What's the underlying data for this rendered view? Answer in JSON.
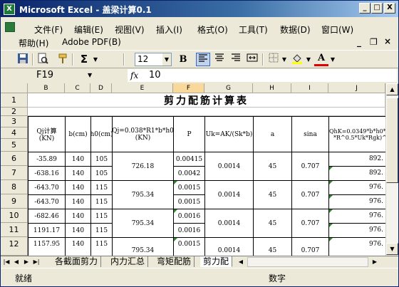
{
  "window": {
    "title": "Microsoft Excel - 盖梁计算0.1",
    "min_label": "_",
    "max_label": "□",
    "close_label": "X"
  },
  "menu": {
    "items": [
      "文件(F)",
      "编辑(E)",
      "视图(V)",
      "插入(I)",
      "格式(O)",
      "工具(T)",
      "数据(D)",
      "窗口(W)"
    ],
    "row2": [
      "帮助(H)",
      "Adobe PDF(B)"
    ],
    "doc_min": "_",
    "doc_restore": "❐",
    "doc_close": "×"
  },
  "toolbar": {
    "font_size": "12",
    "bold": "B",
    "sigma": "Σ"
  },
  "formula_bar": {
    "name_box": "F19",
    "fx": "fx",
    "value": "10"
  },
  "sheet": {
    "columns": [
      "B",
      "C",
      "D",
      "E",
      "F",
      "G",
      "H",
      "I",
      "J"
    ],
    "rows": [
      "1",
      "2",
      "3",
      "4",
      "5",
      "6",
      "7",
      "8",
      "9",
      "10",
      "11",
      "12"
    ],
    "title": "剪力配筋计算表",
    "headers": {
      "qcalc": "Qj计算",
      "qcalc_unit": "(KN)",
      "b": "b(cm)",
      "h0": "h0(cm)",
      "qj": "Qj=0.038*R1*b*h0",
      "qj_unit": "(KN)",
      "p": "P",
      "u": "Uk=AK/(Sk*b)",
      "a": "a",
      "sina": "sina",
      "qhk": "QhK=0.0349*b*h0*((2",
      "qhk2": "*R^0.5*Uk*Rgk)^0.5"
    },
    "data": [
      {
        "q": "-35.89",
        "b": "140",
        "h0": "105",
        "qj": "726.18",
        "p": "0.00415",
        "u": "0.0014",
        "a": "45",
        "sina": "0.707",
        "qhk": "892."
      },
      {
        "q": "-638.16",
        "b": "140",
        "h0": "105",
        "p": "0.0042",
        "qhk": "892."
      },
      {
        "q": "-643.70",
        "b": "140",
        "h0": "115",
        "qj": "795.34",
        "p": "0.0015",
        "u": "0.0014",
        "a": "45",
        "sina": "0.707",
        "qhk": "976."
      },
      {
        "q": "-643.70",
        "b": "140",
        "h0": "115",
        "p": "0.0015",
        "qhk": "976."
      },
      {
        "q": "-682.46",
        "b": "140",
        "h0": "115",
        "qj": "795.34",
        "p": "0.0016",
        "u": "0.0014",
        "a": "45",
        "sina": "0.707",
        "qhk": "976."
      },
      {
        "q": "1191.17",
        "b": "140",
        "h0": "115",
        "p": "0.0016",
        "qhk": "976."
      },
      {
        "q": "1157.95",
        "b": "140",
        "h0": "115",
        "qj": "795.34",
        "p": "0.0015",
        "u": "0.0014",
        "a": "45",
        "sina": "0.707",
        "qhk": "976."
      }
    ]
  },
  "tabs": {
    "items": [
      "各截面剪力",
      "内力汇总",
      "弯矩配筋",
      "剪力配"
    ]
  },
  "status": {
    "left": "就绪",
    "right": "数字"
  }
}
